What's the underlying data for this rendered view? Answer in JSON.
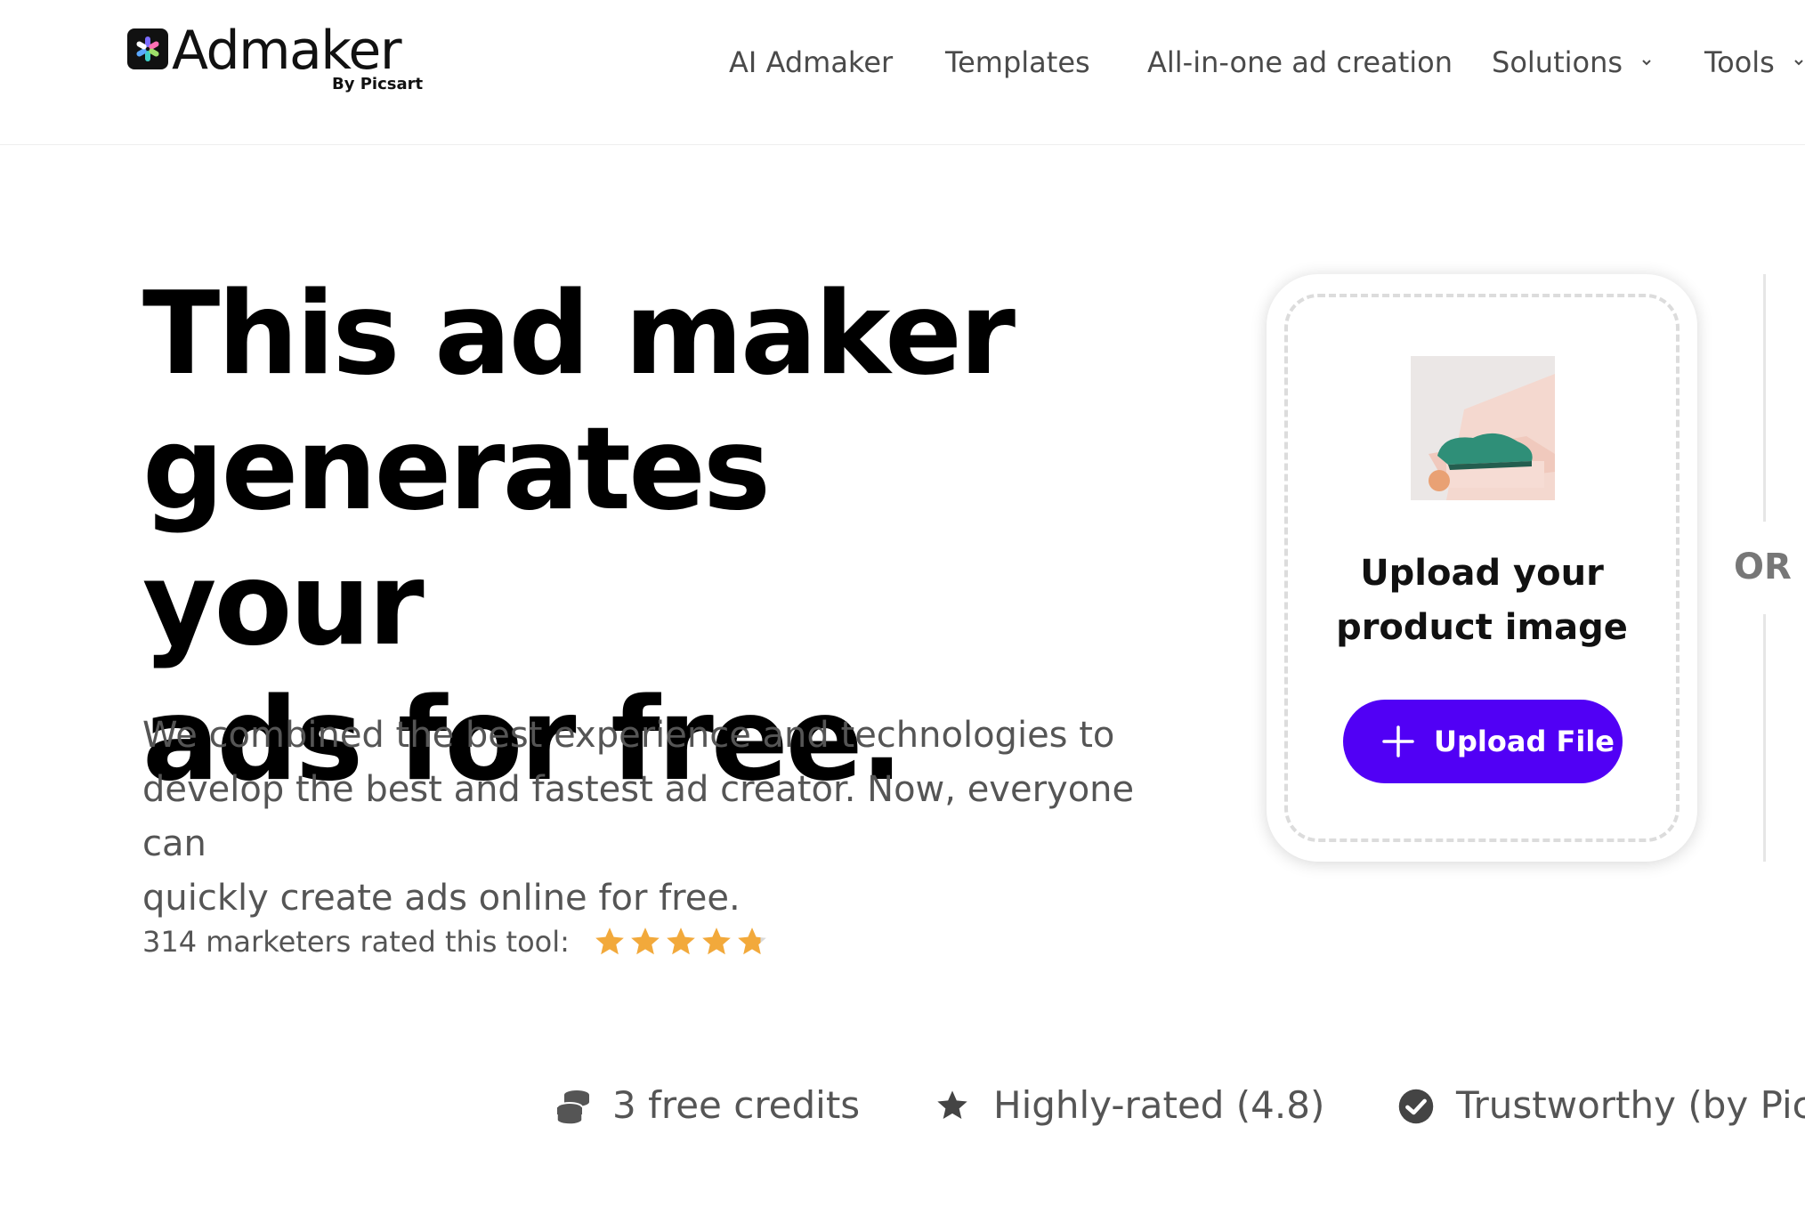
{
  "brand": {
    "name": "Admaker",
    "sub": "By Picsart"
  },
  "nav": {
    "items": [
      {
        "label": "AI Admaker",
        "dropdown": false
      },
      {
        "label": "Templates",
        "dropdown": false
      },
      {
        "label": "All-in-one ad creation",
        "dropdown": false
      },
      {
        "label": "Solutions",
        "dropdown": true
      },
      {
        "label": "Tools",
        "dropdown": true
      }
    ]
  },
  "hero": {
    "title_lines": [
      "This ad maker",
      "generates your",
      "ads for free."
    ],
    "description_lines": [
      "We combined the best experience and technologies to",
      "develop the best and fastest ad creator. Now, everyone can",
      "quickly create ads online for free."
    ],
    "rating_text": "314 marketers rated this tool:",
    "rating_value": 4.8,
    "rating_max": 5
  },
  "upload": {
    "title_lines": [
      "Upload your",
      "product image"
    ],
    "button_label": "Upload File",
    "or_label": "OR"
  },
  "features": [
    {
      "icon": "coins-icon",
      "label": "3 free credits"
    },
    {
      "icon": "star-icon",
      "label": "Highly-rated (4.8)"
    },
    {
      "icon": "check-circle-icon",
      "label": "Trustworthy (by Pics"
    }
  ],
  "colors": {
    "accent": "#5100f5",
    "star": "#f2a93b",
    "text_muted": "#555555",
    "heading": "#000000"
  }
}
